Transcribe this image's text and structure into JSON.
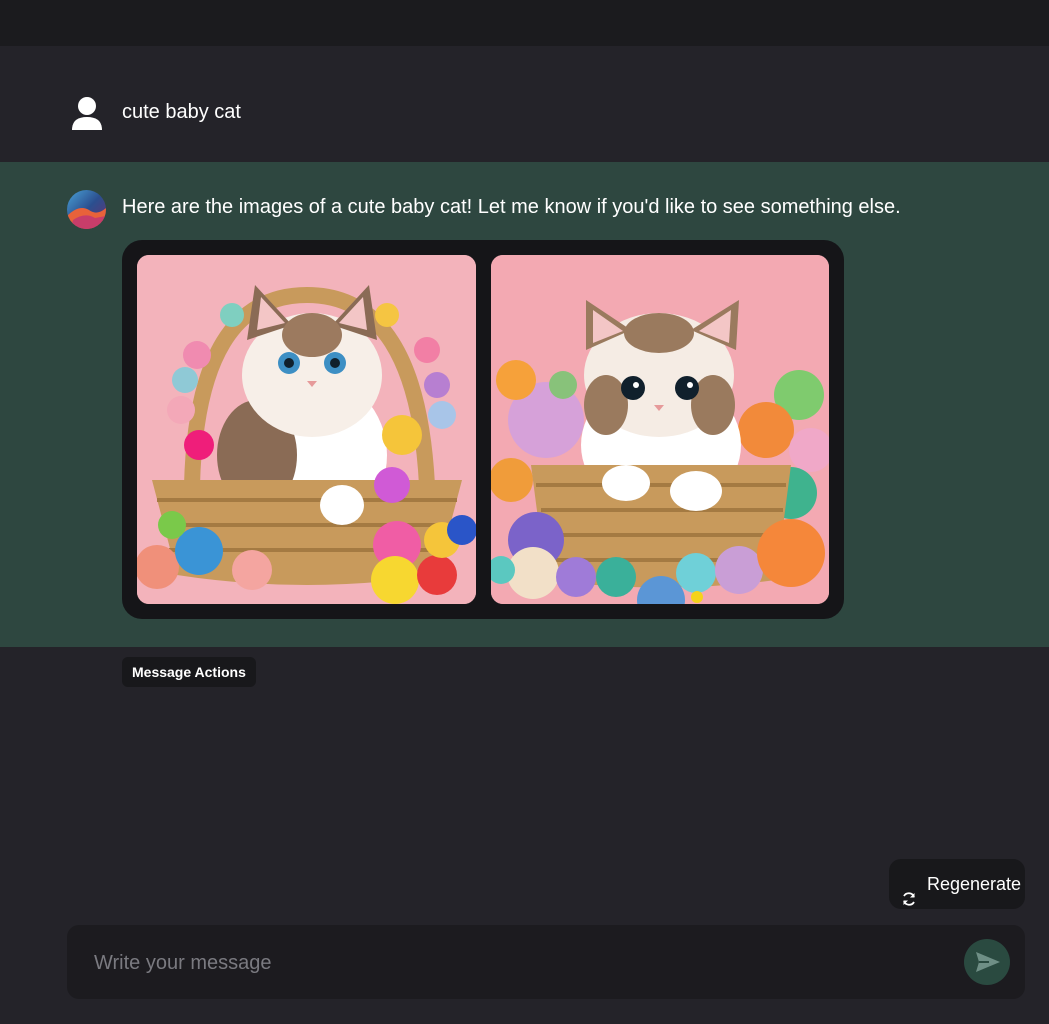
{
  "user_message": {
    "text": "cute baby cat",
    "icon": "user-icon"
  },
  "bot_message": {
    "text": "Here are the images of a cute baby cat! Let me know if you'd like to see something else.",
    "icon": "bot-avatar-icon",
    "images": [
      {
        "alt": "kitten-in-basket-with-yarn-1"
      },
      {
        "alt": "kitten-in-basket-with-yarn-2"
      }
    ]
  },
  "message_actions": {
    "label": "Message Actions"
  },
  "regenerate": {
    "label": "Regenerate",
    "icon": "refresh-icon"
  },
  "composer": {
    "placeholder": "Write your message",
    "send_icon": "send-icon"
  },
  "colors": {
    "background": "#242329",
    "topbar": "#1b1b1e",
    "bot_row": "#2e4740",
    "gallery_bg": "#151518",
    "send_button": "#2a4a40"
  }
}
